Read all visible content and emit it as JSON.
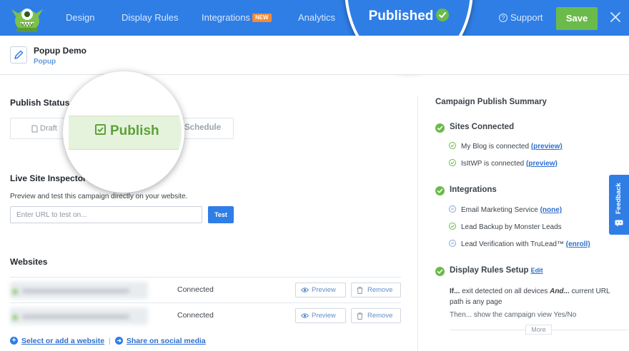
{
  "nav": {
    "items": [
      "Design",
      "Display Rules",
      "Integrations",
      "Analytics"
    ],
    "new_badge": "NEW",
    "published_label": "Published",
    "support_label": "Support",
    "save_label": "Save"
  },
  "campaign": {
    "name": "Popup Demo",
    "type": "Popup"
  },
  "publish_status": {
    "title": "Publish Status",
    "draft_label": "Draft",
    "publish_label": "Publish",
    "schedule_label": "Schedule"
  },
  "inspector": {
    "title": "Live Site Inspector",
    "description": "Preview and test this campaign directly on your website.",
    "url_placeholder": "Enter URL to test on...",
    "test_label": "Test"
  },
  "websites": {
    "title": "Websites",
    "rows": [
      {
        "status": "Connected",
        "preview": "Preview",
        "remove": "Remove"
      },
      {
        "status": "Connected",
        "preview": "Preview",
        "remove": "Remove"
      }
    ],
    "select_link": "Select or add a website",
    "share_link": "Share on social media"
  },
  "summary": {
    "title": "Campaign Publish Summary",
    "sites": {
      "title": "Sites Connected",
      "items": [
        {
          "text": "My Blog is connected ",
          "link": "(preview)"
        },
        {
          "text": "IsItWP is connected ",
          "link": "(preview)"
        }
      ]
    },
    "integrations": {
      "title": "Integrations",
      "items": [
        {
          "text": "Email Marketing Service ",
          "link": "(none)"
        },
        {
          "text": "Lead Backup by Monster Leads",
          "link": ""
        },
        {
          "text": "Lead Verification with TruLead™ ",
          "link": "(enroll)"
        }
      ]
    },
    "display_rules": {
      "title": "Display Rules Setup",
      "edit_label": "Edit",
      "if_label": "If...",
      "if_text": " exit detected on all devices ",
      "and_label": "And...",
      "and_text": " current URL path is any page",
      "then_text": "Then... show the campaign view Yes/No",
      "more_label": "More"
    }
  },
  "feedback_label": "Feedback",
  "colors": {
    "brand_blue": "#2f7ee6",
    "success_green": "#6bbb4a",
    "new_badge": "#f58936"
  }
}
